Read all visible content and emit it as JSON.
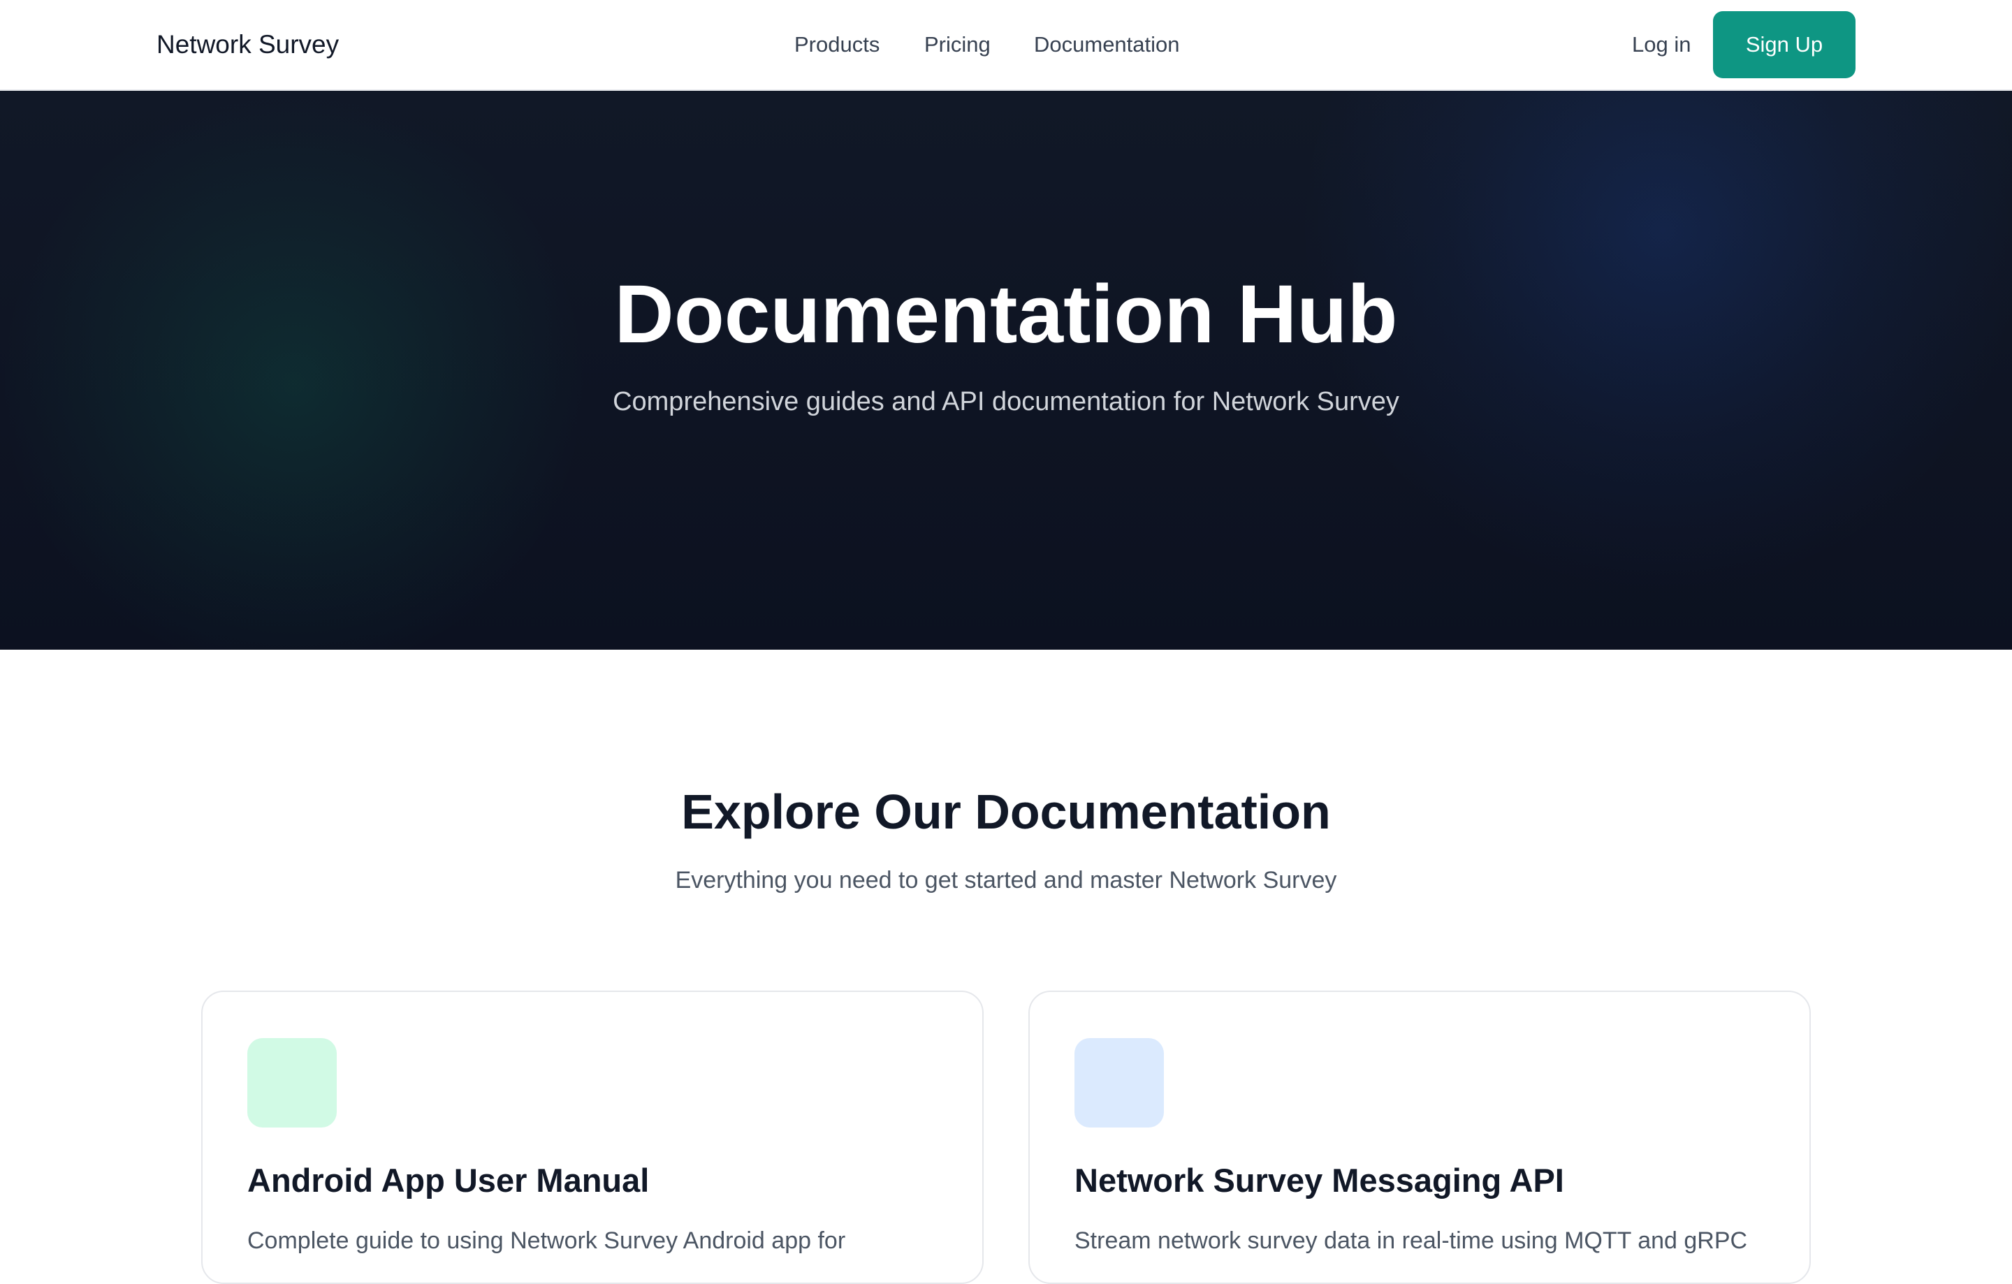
{
  "header": {
    "brand": "Network Survey",
    "nav": [
      "Products",
      "Pricing",
      "Documentation"
    ],
    "login_label": "Log in",
    "signup_label": "Sign Up"
  },
  "hero": {
    "title": "Documentation Hub",
    "subtitle": "Comprehensive guides and API documentation for Network Survey"
  },
  "section": {
    "title": "Explore Our Documentation",
    "subtitle": "Everything you need to get started and master Network Survey"
  },
  "cards": [
    {
      "title": "Android App User Manual",
      "description": "Complete guide to using Network Survey Android app for",
      "icon_color": "#d1fae5"
    },
    {
      "title": "Network Survey Messaging API",
      "description": "Stream network survey data in real-time using MQTT and gRPC",
      "icon_color": "#dbeafe"
    }
  ],
  "colors": {
    "accent": "#0e9683",
    "hero_bg": "#111827"
  }
}
